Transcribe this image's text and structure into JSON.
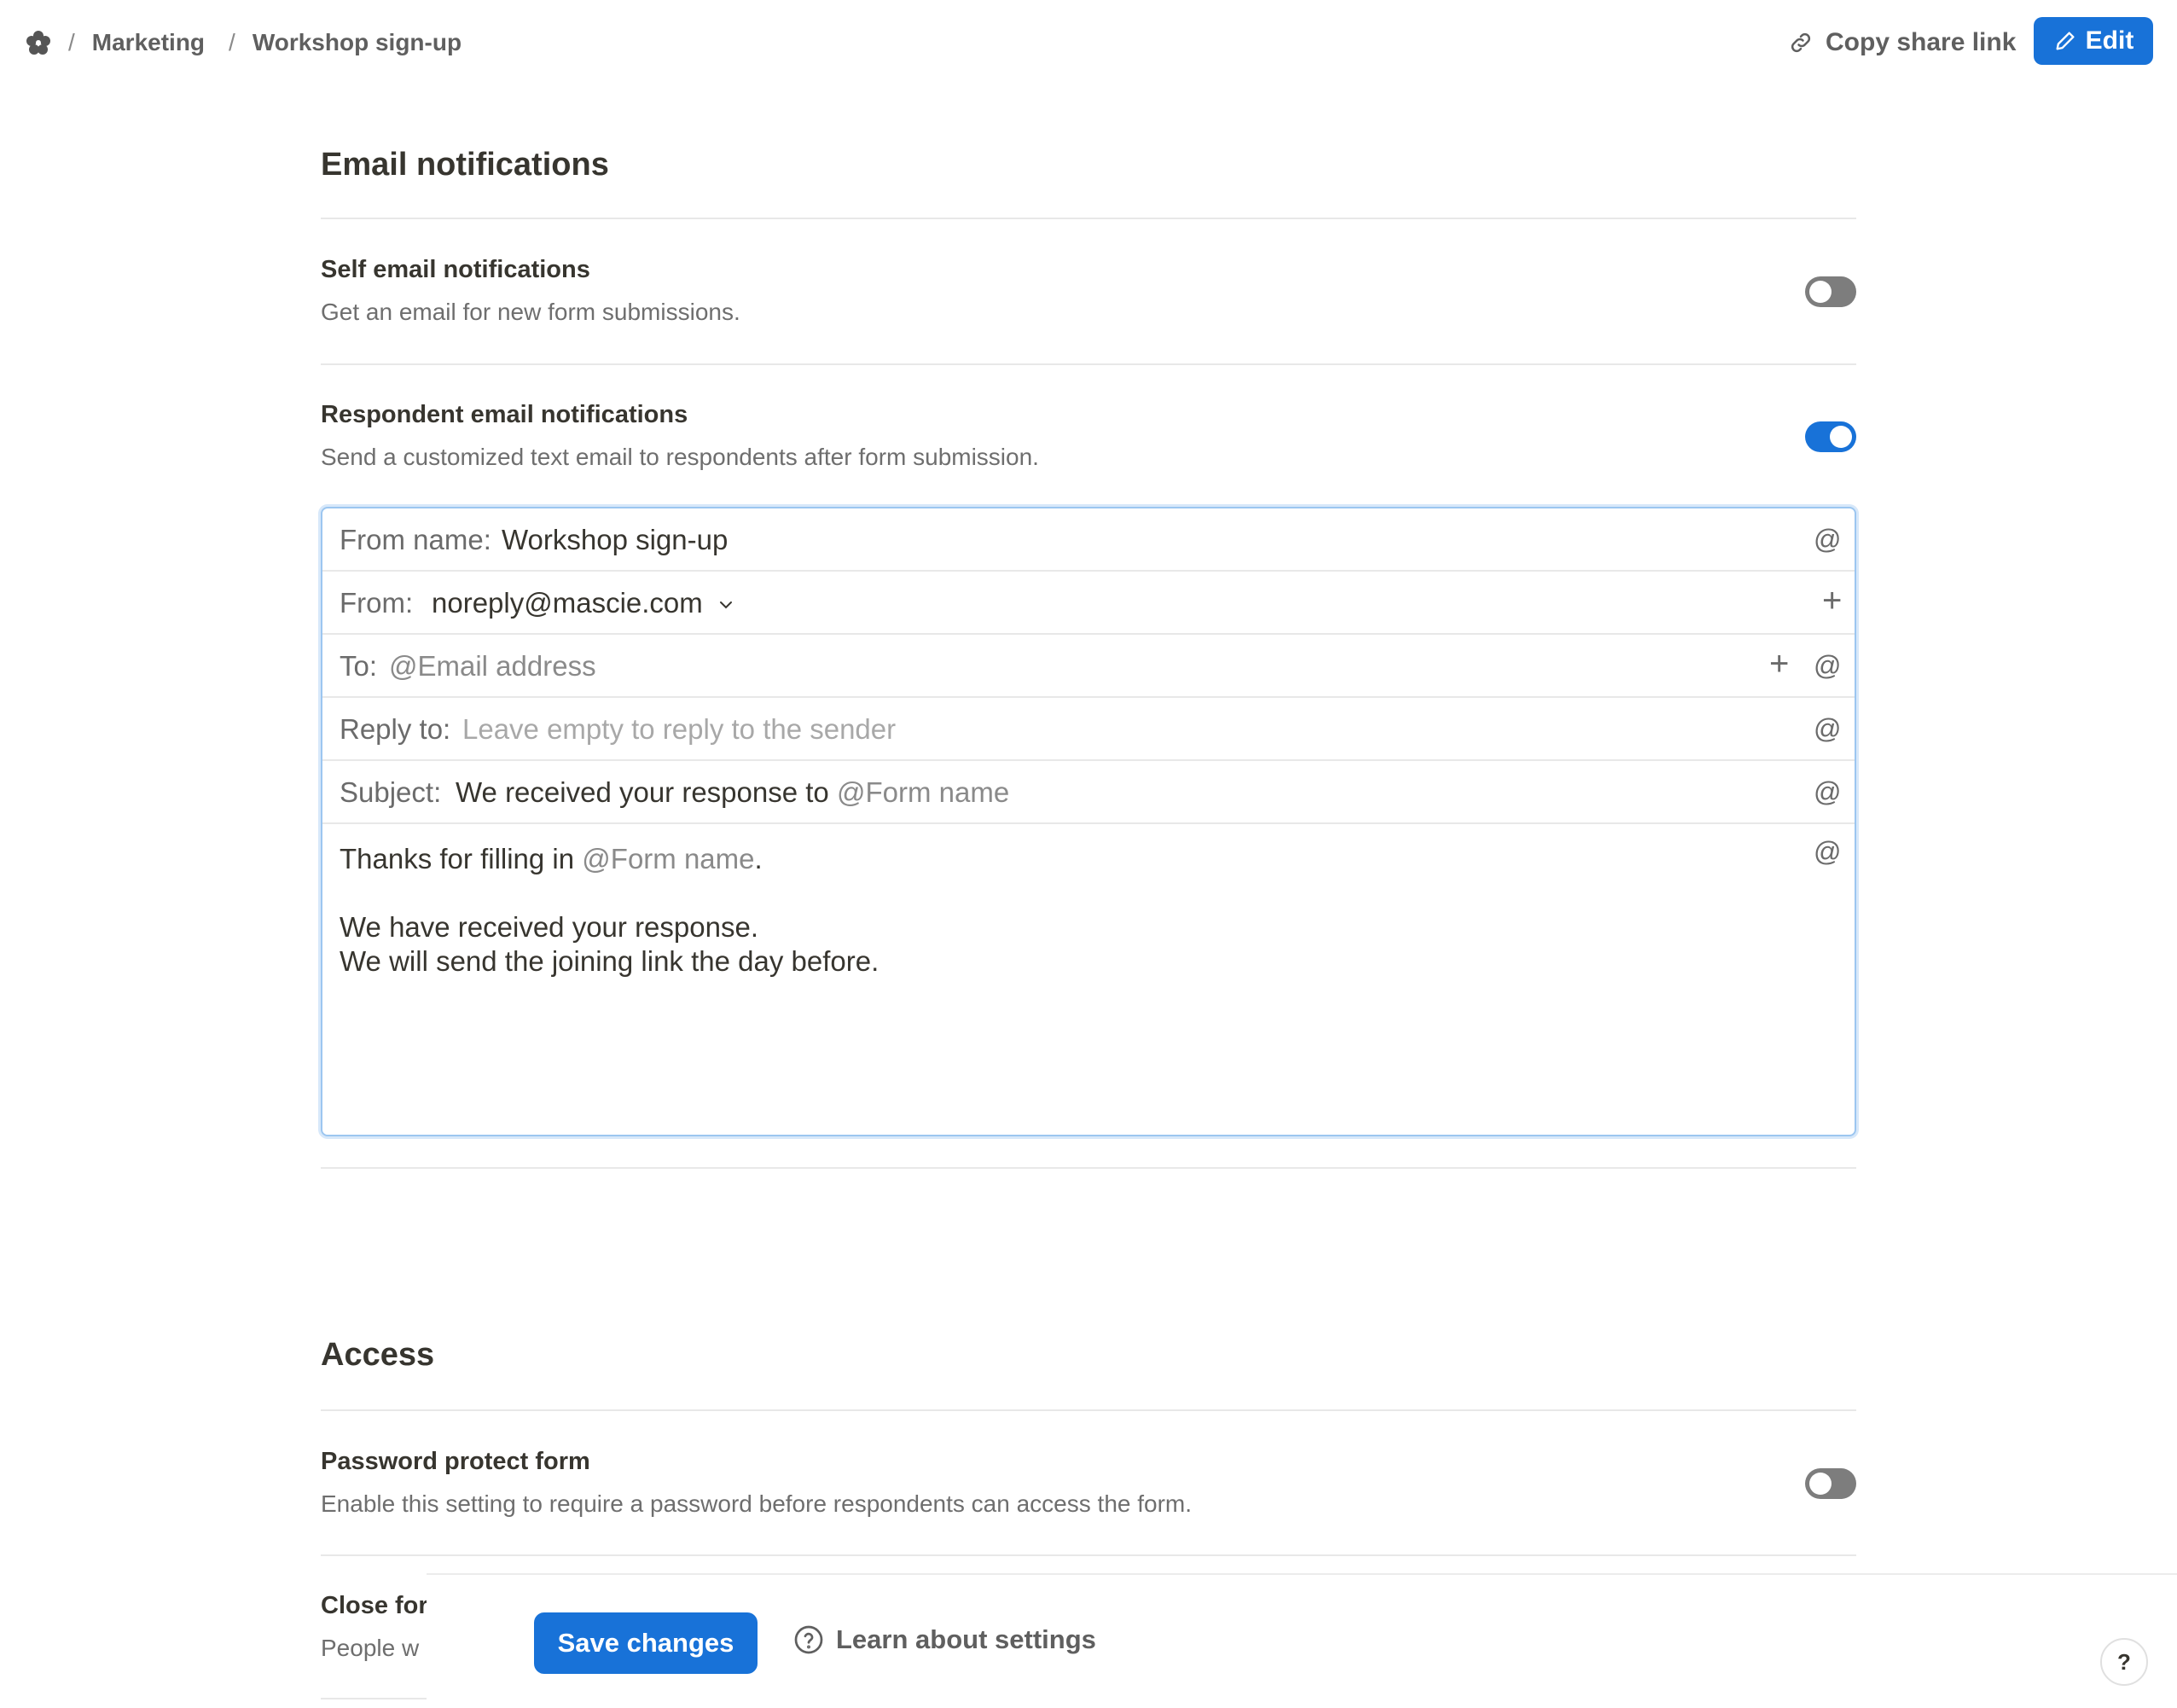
{
  "breadcrumb": {
    "items": [
      "Marketing",
      "Workshop sign-up"
    ],
    "separator": "/"
  },
  "header": {
    "share_label": "Copy share link",
    "edit_label": "Edit"
  },
  "email_notifications": {
    "title": "Email notifications",
    "self": {
      "title": "Self email notifications",
      "description": "Get an email for new form submissions.",
      "enabled": false
    },
    "respondent": {
      "title": "Respondent email notifications",
      "description": "Send a customized text email to respondents after form submission.",
      "enabled": true
    },
    "composer": {
      "from_name_label": "From name:",
      "from_name_value": "Workshop sign-up",
      "from_label": "From:",
      "from_value": "noreply@mascie.com",
      "to_label": "To:",
      "to_value": "@Email address",
      "reply_to_label": "Reply to:",
      "reply_to_placeholder": "Leave empty to reply to the sender",
      "subject_label": "Subject:",
      "subject_text": "We received your response to",
      "subject_mention": "@Form name",
      "body_line1_text": "Thanks for filling in",
      "body_line1_mention": "@Form name",
      "body_line1_end": ".",
      "body_line2": "We have received your response.",
      "body_line3": "We will send the joining link the day before.",
      "at_symbol": "@",
      "plus_symbol": "+"
    }
  },
  "access": {
    "title": "Access",
    "password": {
      "title": "Password protect form",
      "description": "Enable this setting to require a password before respondents can access the form.",
      "enabled": false
    },
    "close_form": {
      "title": "Close for",
      "description": "People w"
    }
  },
  "footer": {
    "save_label": "Save changes",
    "learn_label": "Learn about settings",
    "help_label": "?"
  },
  "colors": {
    "accent": "#1872d8",
    "toggle_off": "#7d7d7d",
    "focus_border": "#9cc6f0"
  },
  "icons": [
    "logo-icon",
    "link-icon",
    "pencil-icon",
    "chevron-down-icon",
    "at-icon",
    "plus-icon",
    "question-circle-icon"
  ]
}
